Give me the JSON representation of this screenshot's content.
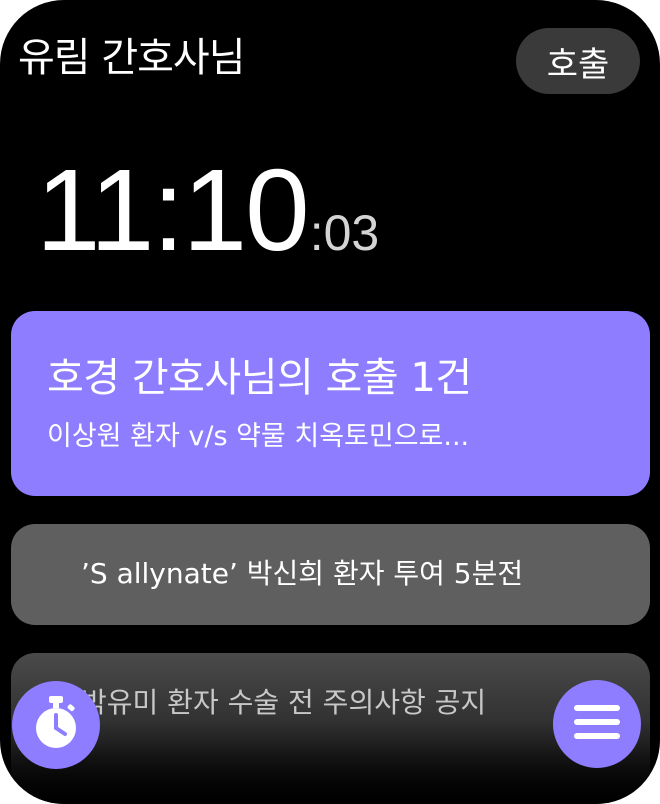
{
  "header": {
    "title": "유림 간호사님",
    "call_button": "호출"
  },
  "clock": {
    "hours_minutes": "11:10",
    "seconds": ":03"
  },
  "notifications": [
    {
      "title": "호경 간호사님의 호출 1건",
      "subtitle": "이상원 환자 v/s 약물 치옥토민으로..."
    },
    {
      "text": "’S allynate’ 박신희 환자 투여 5분전"
    },
    {
      "text": "박유미 환자 수술 전 주의사항 공지"
    }
  ],
  "buttons": {
    "timer_icon": "stopwatch-icon",
    "menu_icon": "hamburger-menu-icon"
  },
  "colors": {
    "accent": "#8f7dff",
    "card_grey": "#5f5f5f",
    "pill_bg": "#3a3a3a",
    "background": "#000000"
  }
}
